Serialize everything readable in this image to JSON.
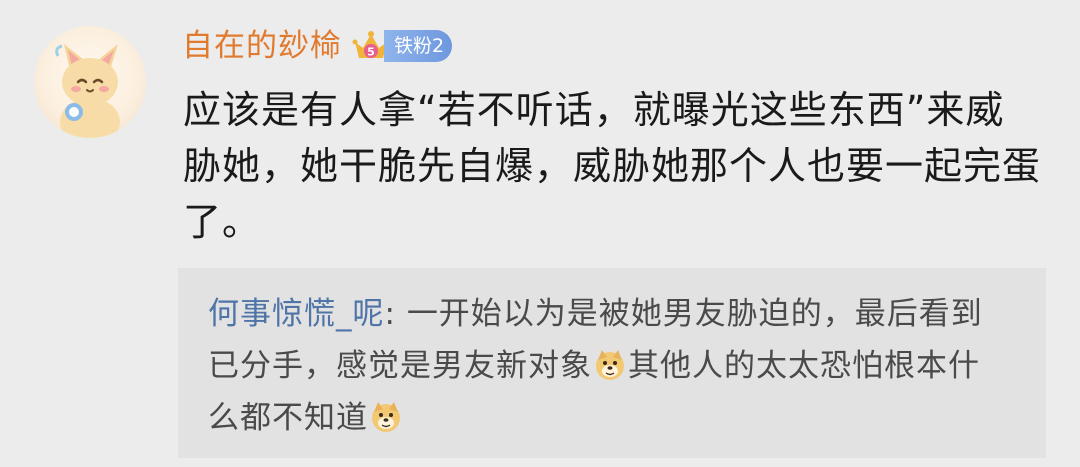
{
  "comment": {
    "username": "自在的玅椧",
    "badge": {
      "level": "5",
      "label": "铁粉2",
      "crown_color": "#f0b43a",
      "label_color": "#7aa3e6"
    },
    "text": "应该是有人拿“若不听话，就曝光这些东西”来威胁她，她干脆先自爆，威胁她那个人也要一起完蛋了。"
  },
  "reply": {
    "username": "何事惊慌_呢",
    "separator": ": ",
    "text_part1": "一开始以为是被她男友胁迫的，最后看到已分手，感觉是男友新对象",
    "emoji_1": "doge-emoji",
    "text_part2": "其他人的太太恐怕根本什么都不知道",
    "emoji_2": "doge-emoji"
  },
  "colors": {
    "username": "#e07a2e",
    "reply_username": "#4f74a8",
    "body_text": "#1a1a1a",
    "reply_text": "#4a4a4a",
    "background": "#ececec",
    "reply_background": "#e2e2e2"
  }
}
